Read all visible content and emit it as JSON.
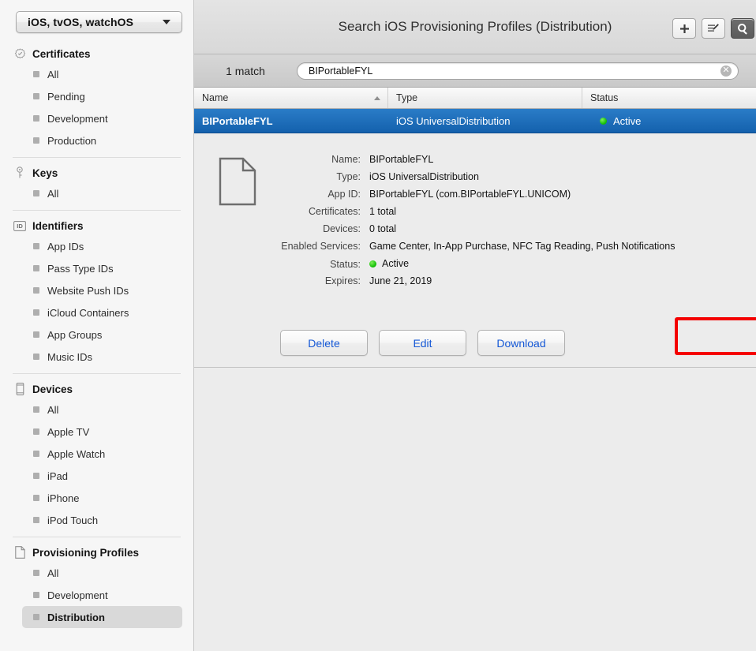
{
  "sidebar": {
    "popup": {
      "label": "iOS, tvOS, watchOS",
      "icon": "chevron-down-icon"
    },
    "groups": [
      {
        "title": "Certificates",
        "icon": "certificate-seal-icon",
        "items": [
          {
            "label": "All",
            "selected": false
          },
          {
            "label": "Pending",
            "selected": false
          },
          {
            "label": "Development",
            "selected": false
          },
          {
            "label": "Production",
            "selected": false
          }
        ]
      },
      {
        "title": "Keys",
        "icon": "key-icon",
        "items": [
          {
            "label": "All",
            "selected": false
          }
        ]
      },
      {
        "title": "Identifiers",
        "icon": "id-badge-icon",
        "items": [
          {
            "label": "App IDs",
            "selected": false
          },
          {
            "label": "Pass Type IDs",
            "selected": false
          },
          {
            "label": "Website Push IDs",
            "selected": false
          },
          {
            "label": "iCloud Containers",
            "selected": false
          },
          {
            "label": "App Groups",
            "selected": false
          },
          {
            "label": "Music IDs",
            "selected": false
          }
        ]
      },
      {
        "title": "Devices",
        "icon": "device-phone-icon",
        "items": [
          {
            "label": "All",
            "selected": false
          },
          {
            "label": "Apple TV",
            "selected": false
          },
          {
            "label": "Apple Watch",
            "selected": false
          },
          {
            "label": "iPad",
            "selected": false
          },
          {
            "label": "iPhone",
            "selected": false
          },
          {
            "label": "iPod Touch",
            "selected": false
          }
        ]
      },
      {
        "title": "Provisioning Profiles",
        "icon": "document-page-icon",
        "items": [
          {
            "label": "All",
            "selected": false
          },
          {
            "label": "Development",
            "selected": false
          },
          {
            "label": "Distribution",
            "selected": true
          }
        ]
      }
    ]
  },
  "titlebar": {
    "title": "Search iOS Provisioning Profiles (Distribution)",
    "buttons": [
      {
        "name": "add-button",
        "glyph": "+",
        "active": false
      },
      {
        "name": "edit-button",
        "glyph": "edit-icon",
        "active": false
      },
      {
        "name": "search-button",
        "glyph": "search-icon",
        "active": true
      }
    ]
  },
  "search": {
    "match_count": "1 match",
    "value": "BIPortableFYL",
    "placeholder": "",
    "clear_glyph": "✕"
  },
  "table": {
    "columns": [
      {
        "label": "Name",
        "sort": "ascending"
      },
      {
        "label": "Type",
        "sort": ""
      },
      {
        "label": "Status",
        "sort": ""
      }
    ],
    "rows": [
      {
        "name": "BIPortableFYL",
        "type": "iOS UniversalDistribution",
        "status": "Active",
        "selected": true
      }
    ]
  },
  "detail": {
    "icon": "document-page-icon",
    "fields": [
      {
        "label": "Name:",
        "value": "BIPortableFYL"
      },
      {
        "label": "Type:",
        "value": "iOS UniversalDistribution"
      },
      {
        "label": "App ID:",
        "value": "BIPortableFYL (com.BIPortableFYL.UNICOM)"
      },
      {
        "label": "Certificates:",
        "value": "1 total"
      },
      {
        "label": "Devices:",
        "value": "0 total"
      },
      {
        "label": "Enabled Services:",
        "value": "Game Center, In-App Purchase, NFC Tag Reading, Push Notifications"
      },
      {
        "label": "Status:",
        "value": "Active",
        "dot": "green"
      },
      {
        "label": "Expires:",
        "value": "June 21, 2019"
      }
    ],
    "buttons": [
      {
        "label": "Delete",
        "highlighted": false
      },
      {
        "label": "Edit",
        "highlighted": false
      },
      {
        "label": "Download",
        "highlighted": true
      }
    ]
  },
  "colors": {
    "selection_blue": "#1461ad",
    "link_blue": "#1558d6",
    "status_green": "#19c20b",
    "highlight_red": "#f40000",
    "sidebar_bg": "#f6f6f6",
    "panel_bg": "#ececec"
  }
}
